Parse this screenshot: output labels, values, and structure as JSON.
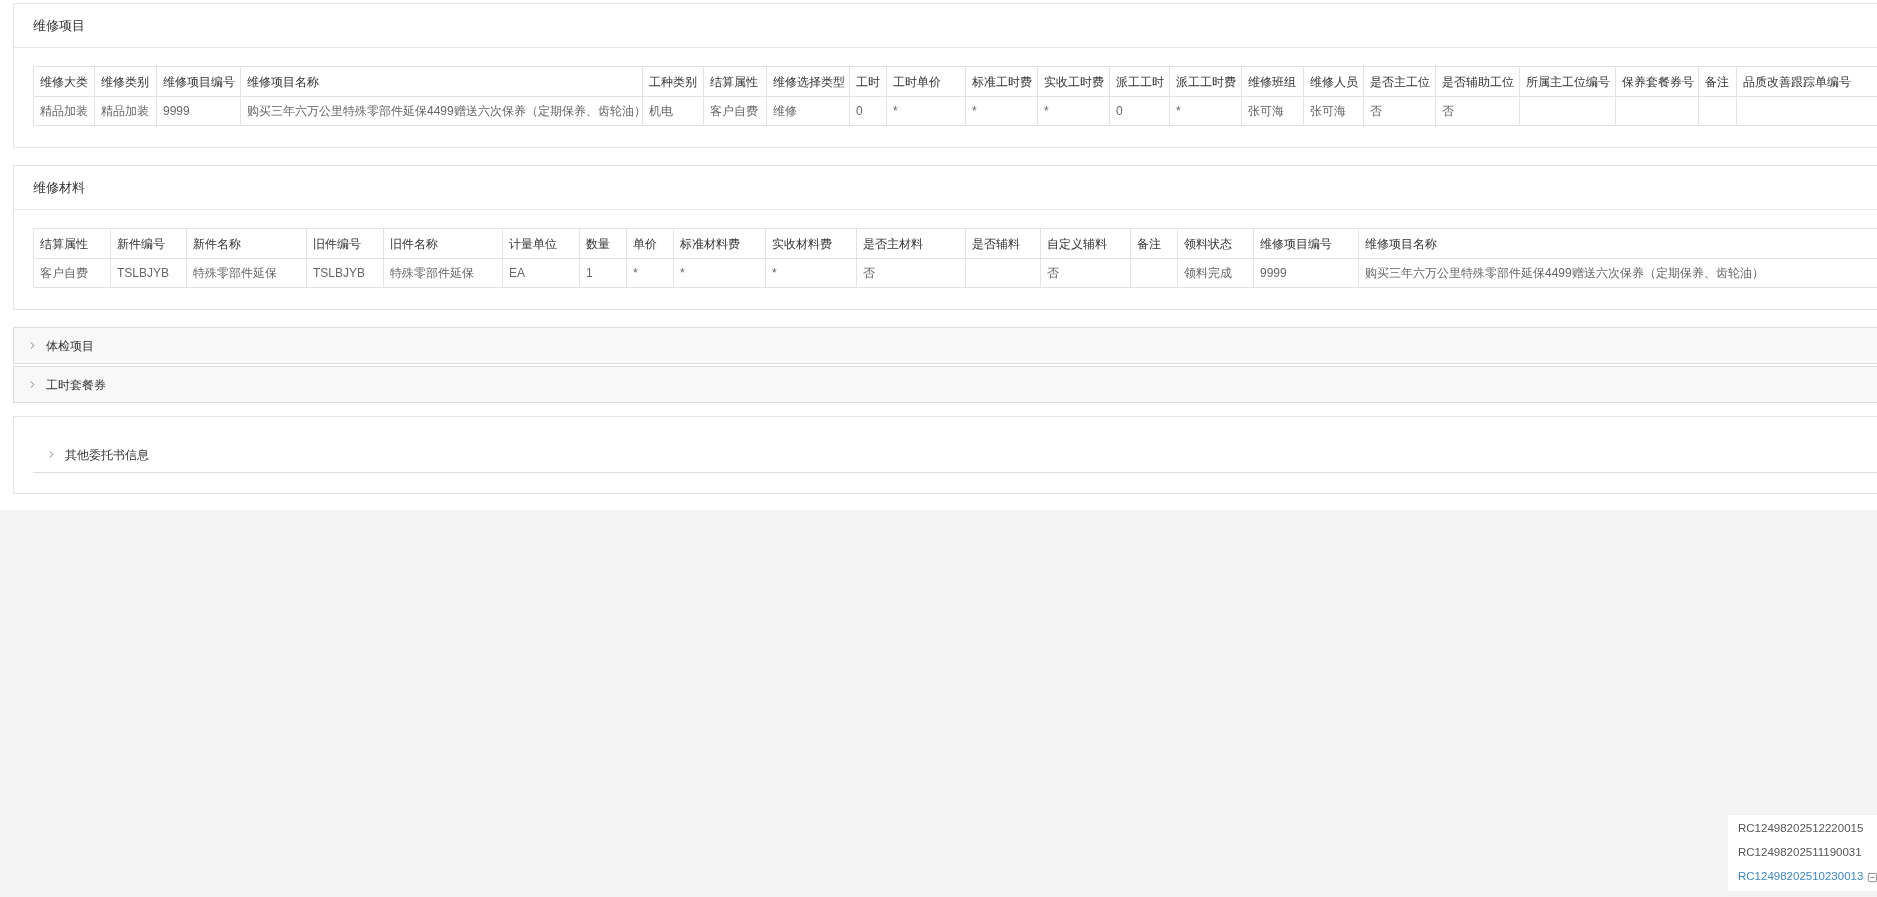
{
  "repair_items": {
    "title": "维修项目",
    "table": {
      "columns": [
        "维修大类",
        "维修类别",
        "维修项目编号",
        "维修项目名称",
        "工种类别",
        "结算属性",
        "维修选择类型",
        "工时",
        "工时单价",
        "标准工时费",
        "实收工时费",
        "派工工时",
        "派工工时费",
        "维修班组",
        "维修人员",
        "是否主工位",
        "是否辅助工位",
        "所属主工位编号",
        "保养套餐券号",
        "备注",
        "品质改善跟踪单编号"
      ],
      "rows": [
        [
          "精品加装",
          "精品加装",
          "9999",
          "购买三年六万公里特殊零部件延保4499赠送六次保养（定期保养、齿轮油）",
          "机电",
          "客户自费",
          "维修",
          "0",
          "*",
          "*",
          "*",
          "0",
          "*",
          "张可海",
          "张可海",
          "否",
          "否",
          null,
          null,
          null,
          null
        ]
      ]
    }
  },
  "repair_materials": {
    "title": "维修材料",
    "table": {
      "columns": [
        "结算属性",
        "新件编号",
        "新件名称",
        "旧件编号",
        "旧件名称",
        "计量单位",
        "数量",
        "单价",
        "标准材料费",
        "实收材料费",
        "是否主材料",
        "是否辅料",
        "自定义辅料",
        "备注",
        "领料状态",
        "维修项目编号",
        "维修项目名称"
      ],
      "rows": [
        [
          "客户自费",
          "TSLBJYB",
          "特殊零部件延保",
          "TSLBJYB",
          "特殊零部件延保",
          "EA",
          "1",
          "*",
          "*",
          "*",
          "否",
          null,
          "否",
          null,
          "领料完成",
          "9999",
          "购买三年六万公里特殊零部件延保4499赠送六次保养（定期保养、齿轮油）"
        ]
      ]
    }
  },
  "collapsible_panels": [
    {
      "label": "体检项目",
      "expanded": false
    },
    {
      "label": "工时套餐券",
      "expanded": false
    }
  ],
  "other_info": {
    "label": "其他委托书信息",
    "expanded": false
  },
  "order_list": {
    "items": [
      {
        "label": "RC12498202512220015",
        "selected": false
      },
      {
        "label": "RC12498202511190031",
        "selected": false
      },
      {
        "label": "RC12498202510230013",
        "selected": true
      }
    ]
  }
}
